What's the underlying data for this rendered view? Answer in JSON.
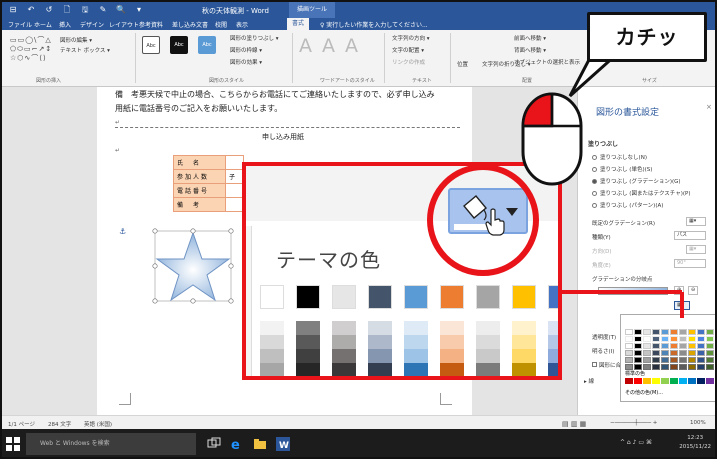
{
  "titlebar": {
    "title": "秋の天体観測 - Word",
    "context_tab": "描画ツール",
    "qat": [
      "⊟",
      "↶",
      "↺",
      "🗋",
      "🖫",
      "✎",
      "🔍",
      "▾"
    ]
  },
  "tabs": [
    "ファイル",
    "ホーム",
    "挿入",
    "デザイン",
    "レイアウト",
    "参考資料",
    "差し込み文書",
    "校閲",
    "表示",
    "書式",
    "♀ 実行したい作業を入力してください..."
  ],
  "ribbon": {
    "shapes_label": "図形の挿入",
    "edit_shape": "図形の編集 ▾",
    "text_box": "テキスト ボックス ▾",
    "style_buttons": [
      "Abc",
      "Abc",
      "Abc"
    ],
    "fill": "図形の塗りつぶし ▾",
    "outline": "図形の枠線 ▾",
    "effects": "図形の効果 ▾",
    "styles_label": "図形のスタイル",
    "wordart_label": "ワードアートのスタイル",
    "wordart_letters": [
      "A",
      "A",
      "A"
    ],
    "text_label": "テキスト",
    "text_direction": "文字列の方向 ▾",
    "text_align": "文字の配置 ▾",
    "text_link": "リンクの作成",
    "position": "位置",
    "wrap": "文字列の折り返し ▾",
    "bring_front": "前面へ移動 ▾",
    "send_back": "背面へ移動 ▾",
    "selection_pane": "オブジェクトの選択と表示",
    "arrange_label": "配置",
    "size_label": "サイズ"
  },
  "document": {
    "line1": "備　考悪天候で中止の場合、こちらからお電話にてご連絡いたしますので、必ず申し込み",
    "line2": "用紙に電話番号のご記入をお願いいたします。",
    "form_title": "申し込み用紙",
    "form_rows": [
      {
        "label": "氏　名",
        "value": ""
      },
      {
        "label": "参加人数",
        "value": "子"
      },
      {
        "label": "電話番号",
        "value": ""
      },
      {
        "label": "備　考",
        "value": ""
      }
    ]
  },
  "pane": {
    "title": "図形の書式設定",
    "section": "塗りつぶし",
    "options": [
      {
        "label": "塗りつぶしなし(N)",
        "on": false
      },
      {
        "label": "塗りつぶし (単色)(S)",
        "on": false
      },
      {
        "label": "塗りつぶし (グラデーション)(G)",
        "on": true
      },
      {
        "label": "塗りつぶし (図またはテクスチャ)(P)",
        "on": false
      },
      {
        "label": "塗りつぶし (パターン)(A)",
        "on": false
      }
    ],
    "preset_gradient": "既定のグラデーション(R)",
    "type": "種類(Y)",
    "type_value": "パス",
    "direction": "方向(D)",
    "angle": "角度(E)",
    "angle_value": "90°",
    "stops": "グラデーションの分岐点",
    "transparency": "透明度(T)",
    "brightness": "明るさ(I)",
    "rotate": "図形に合",
    "line_section": "線"
  },
  "mini_palette": {
    "standard_label": "標準の色",
    "more_colors": "その他の色(M)...",
    "theme_cols": [
      "#ffffff",
      "#000000",
      "#e7e6e6",
      "#44546a",
      "#5b9bd5",
      "#ed7d31",
      "#a5a5a5",
      "#ffc000",
      "#4472c4",
      "#70ad47"
    ],
    "standard": [
      "#c00000",
      "#ff0000",
      "#ffc000",
      "#ffff00",
      "#92d050",
      "#00b050",
      "#00b0f0",
      "#0070c0",
      "#002060",
      "#7030a0"
    ]
  },
  "zoom": {
    "title": "テーマの色",
    "top_row": [
      "#ffffff",
      "#000000",
      "#e7e6e6",
      "#44546a",
      "#5b9bd5",
      "#ed7d31",
      "#a5a5a5",
      "#ffc000",
      "#4472c4"
    ],
    "shade_cols": [
      [
        "#f2f2f2",
        "#d9d9d9",
        "#bfbfbf",
        "#a6a6a6",
        "#808080"
      ],
      [
        "#808080",
        "#595959",
        "#404040",
        "#262626",
        "#0d0d0d"
      ],
      [
        "#d0cece",
        "#aeabab",
        "#757171",
        "#3a3838",
        "#171616"
      ],
      [
        "#d6dce4",
        "#adb9ca",
        "#8496b0",
        "#333f50",
        "#222a35"
      ],
      [
        "#deebf7",
        "#bdd7ee",
        "#9dc3e6",
        "#2e75b6",
        "#1f4e79"
      ],
      [
        "#fbe5d6",
        "#f8cbad",
        "#f4b183",
        "#c55a11",
        "#843c0c"
      ],
      [
        "#ededed",
        "#dbdbdb",
        "#c9c9c9",
        "#7b7b7b",
        "#525252"
      ],
      [
        "#fff2cc",
        "#ffe699",
        "#ffd966",
        "#bf9000",
        "#7f6000"
      ],
      [
        "#dae3f3",
        "#b4c7e7",
        "#8faadc",
        "#2f5597",
        "#203864"
      ]
    ]
  },
  "callout": "カチッ",
  "status": {
    "page": "1/1 ページ",
    "words": "284 文字",
    "lang": "英語 (米国)",
    "zoom": "100%"
  },
  "taskbar": {
    "search": "Web と Windows を検索",
    "time": "12:23",
    "date": "2015/11/22"
  }
}
